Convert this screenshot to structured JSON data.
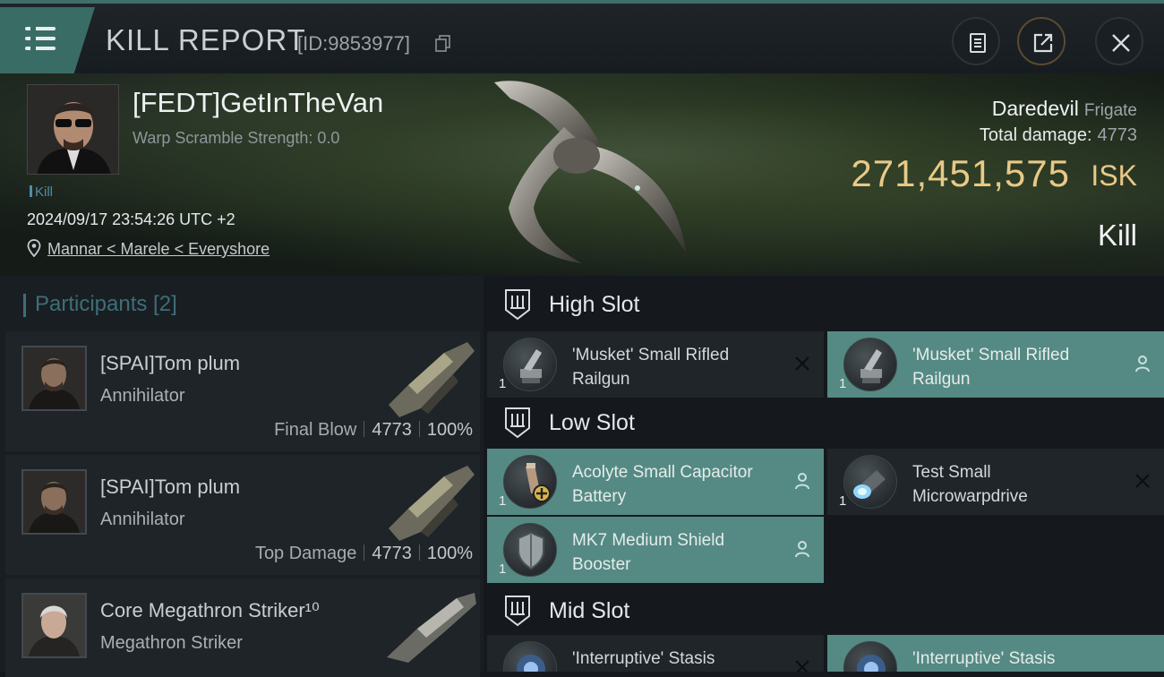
{
  "header": {
    "title": "KILL REPORT",
    "report_id": "[ID:9853977]"
  },
  "victim": {
    "name": "[FEDT]GetInTheVan",
    "warp_scramble": "Warp Scramble Strength: 0.0",
    "tag": "Kill",
    "datetime": "2024/09/17 23:54:26 UTC +2",
    "location": "Mannar < Marele < Everyshore",
    "ship_name": "Daredevil",
    "ship_class": "Frigate",
    "total_damage_label": "Total damage:",
    "total_damage_value": "4773",
    "isk_value": "271,451,575",
    "isk_unit": "ISK",
    "result": "Kill"
  },
  "participants": {
    "title": "Participants [2]",
    "items": [
      {
        "name": "[SPAI]Tom plum",
        "ship": "Annihilator",
        "label": "Final Blow",
        "damage": "4773",
        "percent": "100%"
      },
      {
        "name": "[SPAI]Tom plum",
        "ship": "Annihilator",
        "label": "Top Damage",
        "damage": "4773",
        "percent": "100%"
      },
      {
        "name": "Core Megathron Striker¹⁰",
        "ship": "Megathron Striker"
      }
    ]
  },
  "slots": {
    "high": {
      "label": "High Slot",
      "modules": [
        {
          "qty": "1",
          "name": "'Musket' Small Rifled Railgun",
          "state": "dropped",
          "icon": "railgun-icon",
          "status_icon": "close-icon"
        },
        {
          "qty": "1",
          "name": "'Musket' Small Rifled Railgun",
          "state": "fitted",
          "icon": "railgun-icon",
          "status_icon": "person-icon"
        }
      ]
    },
    "low": {
      "label": "Low Slot",
      "modules": [
        {
          "qty": "1",
          "name": "Acolyte Small Capacitor Battery",
          "state": "fitted",
          "icon": "capacitor-battery-icon",
          "status_icon": "person-icon"
        },
        {
          "qty": "1",
          "name": "Test Small Microwarpdrive",
          "state": "dropped",
          "icon": "microwarpdrive-icon",
          "status_icon": "close-icon"
        },
        {
          "qty": "1",
          "name": "MK7 Medium Shield Booster",
          "state": "fitted",
          "icon": "shield-booster-icon",
          "status_icon": "person-icon"
        }
      ]
    },
    "mid": {
      "label": "Mid Slot",
      "modules": [
        {
          "name": "'Interruptive' Stasis",
          "state": "dropped",
          "icon": "stasis-web-icon",
          "status_icon": "close-icon"
        },
        {
          "name": "'Interruptive' Stasis",
          "state": "fitted",
          "icon": "stasis-web-icon"
        }
      ]
    }
  },
  "colors": {
    "accent_teal": "#3a6c66",
    "fitted_bg": "#548a83",
    "isk_gold": "#e8c987",
    "kill_tag_blue": "#4d8ea7"
  }
}
